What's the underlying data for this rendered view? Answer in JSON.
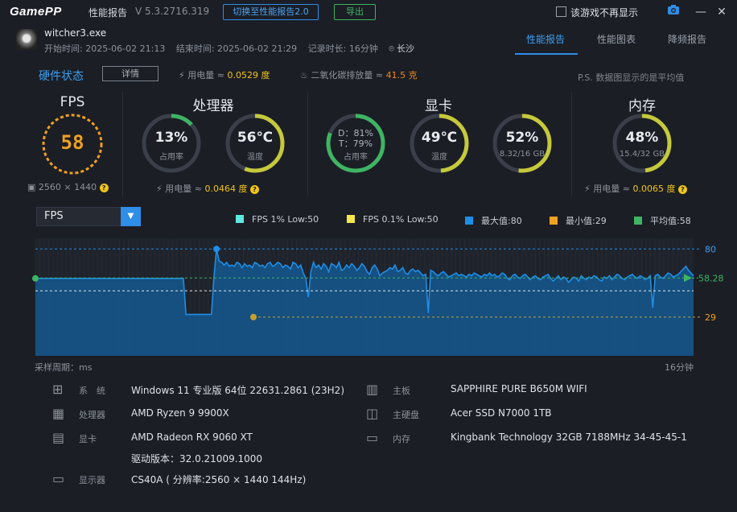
{
  "titlebar": {
    "logo": "GamePP",
    "title": "性能报告",
    "version": "V 5.3.2716.319",
    "switch_button": "切换至性能报告2.0",
    "export_button": "导出",
    "no_show_label": "该游戏不再显示"
  },
  "game": {
    "name": "witcher3.exe",
    "start": "开始时间: 2025-06-02 21:13",
    "end": "结束时间: 2025-06-02 21:29",
    "duration": "记录时长: 16分钟",
    "city": "长沙"
  },
  "tabs": [
    "性能报告",
    "性能图表",
    "降频报告"
  ],
  "hardware": {
    "title": "硬件状态",
    "detail_button": "详情",
    "power_label": "用电量 ≈",
    "power_value": "0.0529 度",
    "co2_label": "二氧化碳排放量 ≈",
    "co2_value": "41.5 克",
    "note": "P.S. 数据图显示的是平均值"
  },
  "fps": {
    "title": "FPS",
    "value": "58",
    "resolution": "2560 × 1440"
  },
  "cpu": {
    "title": "处理器",
    "usage_value": "13%",
    "usage_label": "占用率",
    "usage": 0.13,
    "temp_value": "56℃",
    "temp_label": "温度",
    "temp": 0.56,
    "power_label": "用电量 ≈",
    "power_value": "0.0464 度"
  },
  "gpu": {
    "title": "显卡",
    "usage_d": "D：81%",
    "usage_t": "T：79%",
    "usage_label": "占用率",
    "usage": 0.81,
    "temp_value": "49℃",
    "temp_label": "温度",
    "temp": 0.49,
    "vram_value": "52%",
    "vram_detail": "8.32/16 GB",
    "vram": 0.52
  },
  "memory": {
    "title": "内存",
    "value": "48%",
    "detail": "15.4/32 GB",
    "usage": 0.48,
    "power_label": "用电量 ≈",
    "power_value": "0.0065 度"
  },
  "chart_controls": {
    "metric": "FPS",
    "legend": [
      {
        "label": "FPS 1% Low:50",
        "color": "#5ee8e0"
      },
      {
        "label": "FPS 0.1% Low:50",
        "color": "#f5e64a"
      },
      {
        "label": "最大值:80",
        "color": "#1e8ee8"
      },
      {
        "label": "最小值:29",
        "color": "#f0a020"
      },
      {
        "label": "平均值:58",
        "color": "#3fb463"
      }
    ]
  },
  "chart_data": {
    "type": "area",
    "series": [
      {
        "name": "FPS",
        "values": [
          58,
          58,
          58,
          58,
          58,
          58,
          58,
          58,
          58,
          58,
          58,
          58,
          58,
          58,
          58,
          58,
          58,
          58,
          58,
          58,
          58,
          58,
          58,
          58,
          58,
          58,
          58,
          58,
          58,
          58,
          58,
          58,
          58,
          58,
          58,
          58,
          58,
          58,
          58,
          58,
          58,
          58,
          58,
          58,
          58,
          58,
          58,
          58,
          58,
          58,
          58,
          58,
          58,
          58,
          58,
          58,
          58,
          58,
          58,
          31,
          31,
          31,
          31,
          31,
          31,
          31,
          31,
          31,
          31,
          31,
          59,
          80,
          71,
          70,
          68,
          70,
          67,
          68,
          67,
          70,
          69,
          66,
          69,
          67,
          68,
          66,
          70,
          69,
          67,
          68,
          66,
          69,
          70,
          67,
          68,
          70,
          69,
          66,
          68,
          67,
          65,
          70,
          69,
          66,
          68,
          62,
          58,
          44,
          63,
          70,
          66,
          68,
          65,
          69,
          67,
          63,
          69,
          68,
          66,
          70,
          64,
          65,
          68,
          66,
          69,
          67,
          64,
          66,
          69,
          67,
          63,
          61,
          66,
          68,
          65,
          60,
          62,
          63,
          64,
          66,
          65,
          68,
          63,
          64,
          66,
          62,
          61,
          64,
          65,
          63,
          64,
          62,
          60,
          61,
          32,
          64,
          63,
          61,
          60,
          62,
          63,
          61,
          59,
          60,
          61,
          62,
          60,
          61,
          60,
          59,
          61,
          60,
          62,
          61,
          60,
          59,
          61,
          60,
          62,
          60,
          61,
          59,
          60,
          62,
          61,
          58,
          57,
          60,
          61,
          59,
          58,
          60,
          61,
          59,
          57,
          59,
          60,
          58,
          57,
          59,
          60,
          61,
          58,
          56,
          58,
          60,
          57,
          59,
          58,
          55,
          57,
          59,
          58,
          56,
          60,
          58,
          57,
          59,
          58,
          60,
          59,
          57,
          56,
          59,
          58,
          60,
          57,
          59,
          61,
          60,
          58,
          57,
          59,
          60,
          61,
          59,
          58,
          60,
          59,
          57,
          58,
          60,
          36,
          60,
          61,
          59,
          58,
          60,
          62,
          61,
          59,
          60,
          61,
          63,
          65,
          67,
          64,
          62,
          60
        ]
      }
    ],
    "avg": 58.28,
    "max": 80,
    "min": 29,
    "ylim": [
      0,
      88
    ],
    "y_labels": {
      "max": "80",
      "avg": "58.28",
      "min": "29"
    },
    "xlabel": "采样周期：ms",
    "x_end_label": "16分钟"
  },
  "system": {
    "rows": [
      {
        "label": "系　统",
        "value": "Windows 11 专业版 64位 22631.2861 (23H2)"
      },
      {
        "label": "处理器",
        "value": "AMD Ryzen 9 9900X"
      },
      {
        "label": "显卡",
        "value": "AMD Radeon RX 9060 XT"
      },
      {
        "label": "",
        "value": "驱动版本：32.0.21009.1000"
      },
      {
        "label": "显示器",
        "value": "CS40A ( 分辨率:2560 × 1440 144Hz)"
      }
    ],
    "right_rows": [
      {
        "label": "主板",
        "value": "SAPPHIRE PURE B650M WIFI"
      },
      {
        "label": "主硬盘",
        "value": "Acer SSD N7000 1TB"
      },
      {
        "label": "内存",
        "value": "Kingbank Technology 32GB 7188MHz 34-45-45-1"
      }
    ]
  }
}
